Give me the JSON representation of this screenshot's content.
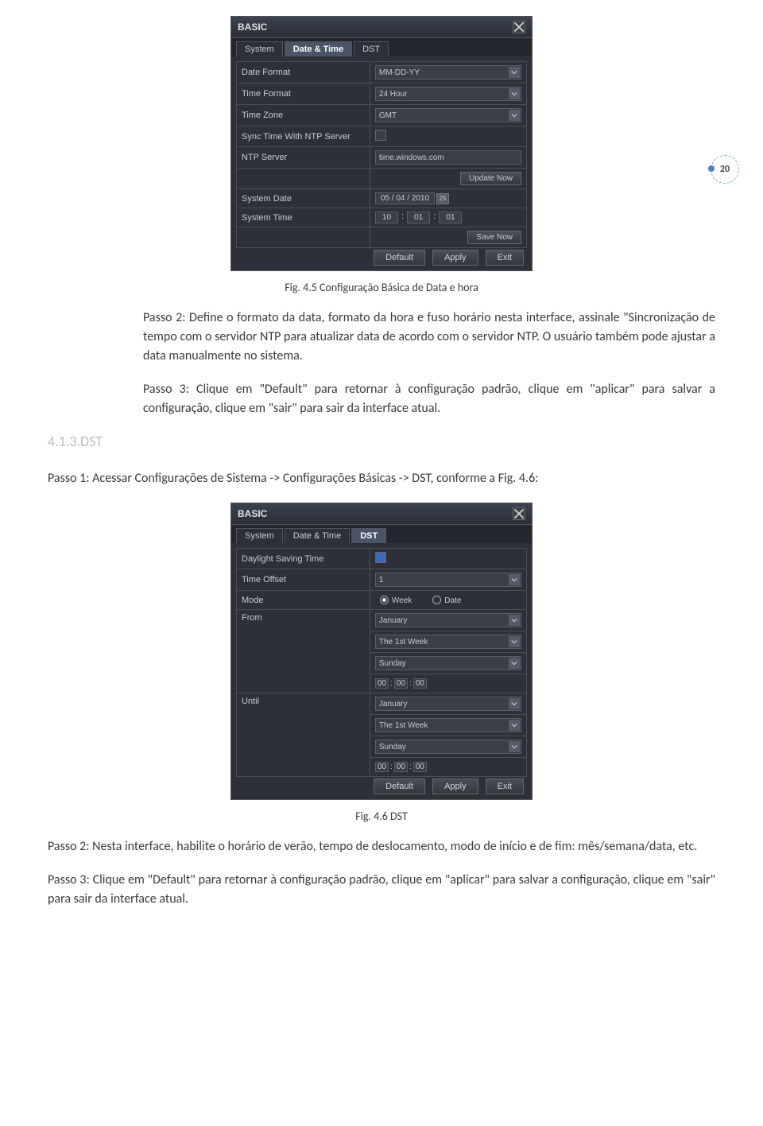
{
  "page_number": "20",
  "dialog1": {
    "title": "BASIC",
    "tabs": [
      "System",
      "Date & Time",
      "DST"
    ],
    "active_tab": 1,
    "rows": {
      "date_format_lbl": "Date Format",
      "date_format_val": "MM-DD-YY",
      "time_format_lbl": "Time Format",
      "time_format_val": "24 Hour",
      "time_zone_lbl": "Time Zone",
      "time_zone_val": "GMT",
      "sync_lbl": "Sync Time With NTP Server",
      "ntp_lbl": "NTP Server",
      "ntp_val": "time.windows.com",
      "update_btn": "Update Now",
      "sys_date_lbl": "System Date",
      "sys_date_val": "05 / 04 / 2010",
      "sys_date_day": "25",
      "sys_time_lbl": "System Time",
      "sys_time_h": "10",
      "sys_time_m": "01",
      "sys_time_s": "01",
      "save_btn": "Save Now"
    },
    "buttons": {
      "default": "Default",
      "apply": "Apply",
      "exit": "Exit"
    }
  },
  "caption1": "Fig. 4.5 Configuração Básica de Data e hora",
  "para1": "Passo 2: Define o formato da data, formato da hora e fuso horário nesta interface, assinale \"Sincronização de tempo com o servidor NTP para atualizar data de acordo com o servidor NTP. O usuário também pode ajustar a data manualmente no sistema.",
  "para2": "Passo 3: Clique em \"Default\" para retornar à configuração padrão, clique em \"aplicar\" para salvar a configuração, clique em \"sair\" para sair da interface atual.",
  "section_dst": "4.1.3.DST",
  "para3": "Passo 1: Acessar Configurações de Sistema -> Configurações Básicas -> DST, conforme a Fig. 4.6:",
  "dialog2": {
    "title": "BASIC",
    "tabs": [
      "System",
      "Date & Time",
      "DST"
    ],
    "active_tab": 2,
    "rows": {
      "dst_lbl": "Daylight Saving Time",
      "offset_lbl": "Time Offset",
      "offset_val": "1",
      "mode_lbl": "Mode",
      "mode_week": "Week",
      "mode_date": "Date",
      "from_lbl": "From",
      "from_month": "January",
      "from_week": "The 1st Week",
      "from_day": "Sunday",
      "from_h": "00",
      "from_m": "00",
      "from_s": "00",
      "until_lbl": "Until",
      "until_month": "January",
      "until_week": "The 1st Week",
      "until_day": "Sunday",
      "until_h": "00",
      "until_m": "00",
      "until_s": "00"
    },
    "buttons": {
      "default": "Default",
      "apply": "Apply",
      "exit": "Exit"
    }
  },
  "caption2": "Fig. 4.6 DST",
  "para4": "Passo 2: Nesta interface, habilite o horário de verão, tempo de deslocamento, modo de início e de fim: mês/semana/data, etc.",
  "para5": "Passo 3: Clique em \"Default\" para retornar à configuração padrão, clique em \"aplicar\" para salvar a configuração, clique em \"sair\" para sair da interface atual."
}
